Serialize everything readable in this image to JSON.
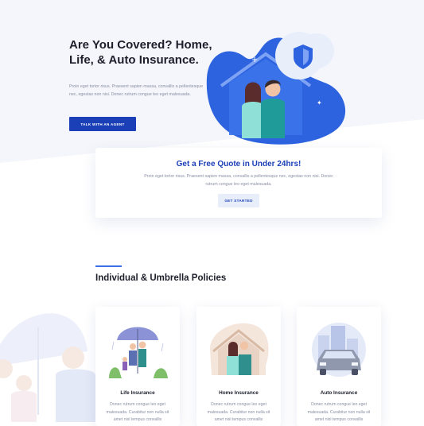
{
  "hero": {
    "title": "Are You Covered? Home, Life, & Auto Insurance.",
    "description": "Proin eget tortor risus. Praesent sapien massa, convallis a pellentesque nec, egestas non nisi. Donec rutrum congue leo eget malesuada.",
    "cta_label": "TALK WITH AN AGENT"
  },
  "quote": {
    "title": "Get a Free Quote in Under 24hrs!",
    "description": "Proin eget tortor risus. Praesent sapien massa, convallis a pellentesque nec, egestas non nisi. Donec rutrum congue leo eget malesuada.",
    "button_label": "GET STARTED"
  },
  "policies": {
    "section_title": "Individual & Umbrella Policies",
    "cards": [
      {
        "title": "Life Insurance",
        "text": "Donec rutrum congue leo eget malesuada. Curabitur non nulla sit amet nisl tempus convallis",
        "icon": "umbrella-family-icon"
      },
      {
        "title": "Home Insurance",
        "text": "Donec rutrum congue leo eget malesuada. Curabitur non nulla sit amet nisl tempus convallis",
        "icon": "home-couple-icon"
      },
      {
        "title": "Auto Insurance",
        "text": "Donec rutrum congue leo eget malesuada. Curabitur non nulla sit amet nisl tempus convallis",
        "icon": "car-city-icon"
      }
    ]
  },
  "colors": {
    "primary": "#1b3fb7",
    "accent": "#3d6fe6",
    "hero_background": "#f4f6fb",
    "heading": "#1d1f2b",
    "body_text": "#8a8fa3",
    "secondary_button": "#e8edfa"
  }
}
